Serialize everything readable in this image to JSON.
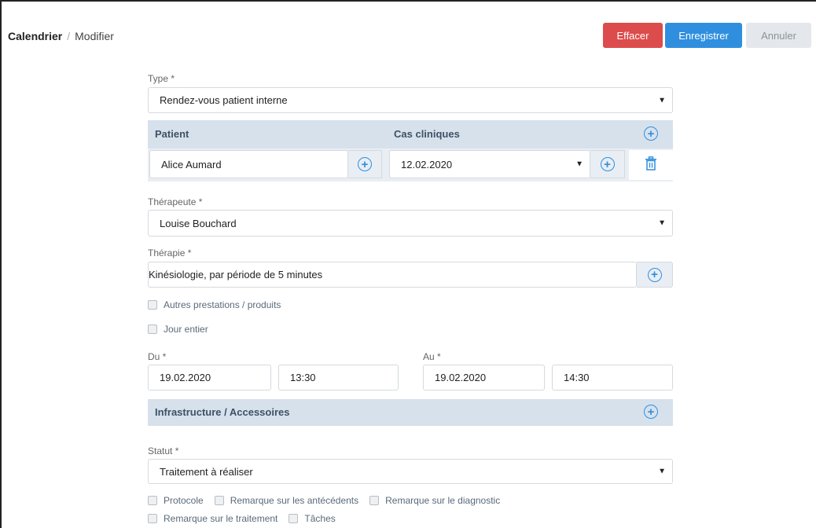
{
  "breadcrumb": {
    "root": "Calendrier",
    "separator": "/",
    "current": "Modifier"
  },
  "toolbar": {
    "delete_label": "Effacer",
    "save_label": "Enregistrer",
    "cancel_label": "Annuler"
  },
  "colors": {
    "delete": "#dc4c4c",
    "save": "#2f8fde",
    "cancel_bg": "#e4e8ed",
    "band": "#d7e1ec"
  },
  "type": {
    "label": "Type *",
    "value": "Rendez-vous patient interne"
  },
  "patient_section": {
    "patient_header": "Patient",
    "cases_header": "Cas cliniques",
    "patient_value": "Alice Aumard",
    "case_value": "12.02.2020"
  },
  "therapist": {
    "label": "Thérapeute *",
    "value": "Louise Bouchard"
  },
  "therapy": {
    "label": "Thérapie *",
    "value": "Kinésiologie, par période de 5 minutes"
  },
  "options": {
    "other_services": "Autres prestations / produits",
    "all_day": "Jour entier"
  },
  "from": {
    "label": "Du *",
    "date": "19.02.2020",
    "time": "13:30"
  },
  "to": {
    "label": "Au *",
    "date": "19.02.2020",
    "time": "14:30"
  },
  "infrastructure": {
    "header": "Infrastructure / Accessoires"
  },
  "status": {
    "label": "Statut *",
    "value": "Traitement à réaliser"
  },
  "checks": {
    "protocol": "Protocole",
    "history_remark": "Remarque sur les antécédents",
    "diagnosis_remark": "Remarque sur le diagnostic",
    "treatment_remark": "Remarque sur le traitement",
    "tasks": "Tâches"
  },
  "icons": {
    "add": "plus-circle-icon",
    "dropdown": "caret-down-icon",
    "delete": "trash-icon",
    "checkbox": "checkbox-icon"
  }
}
